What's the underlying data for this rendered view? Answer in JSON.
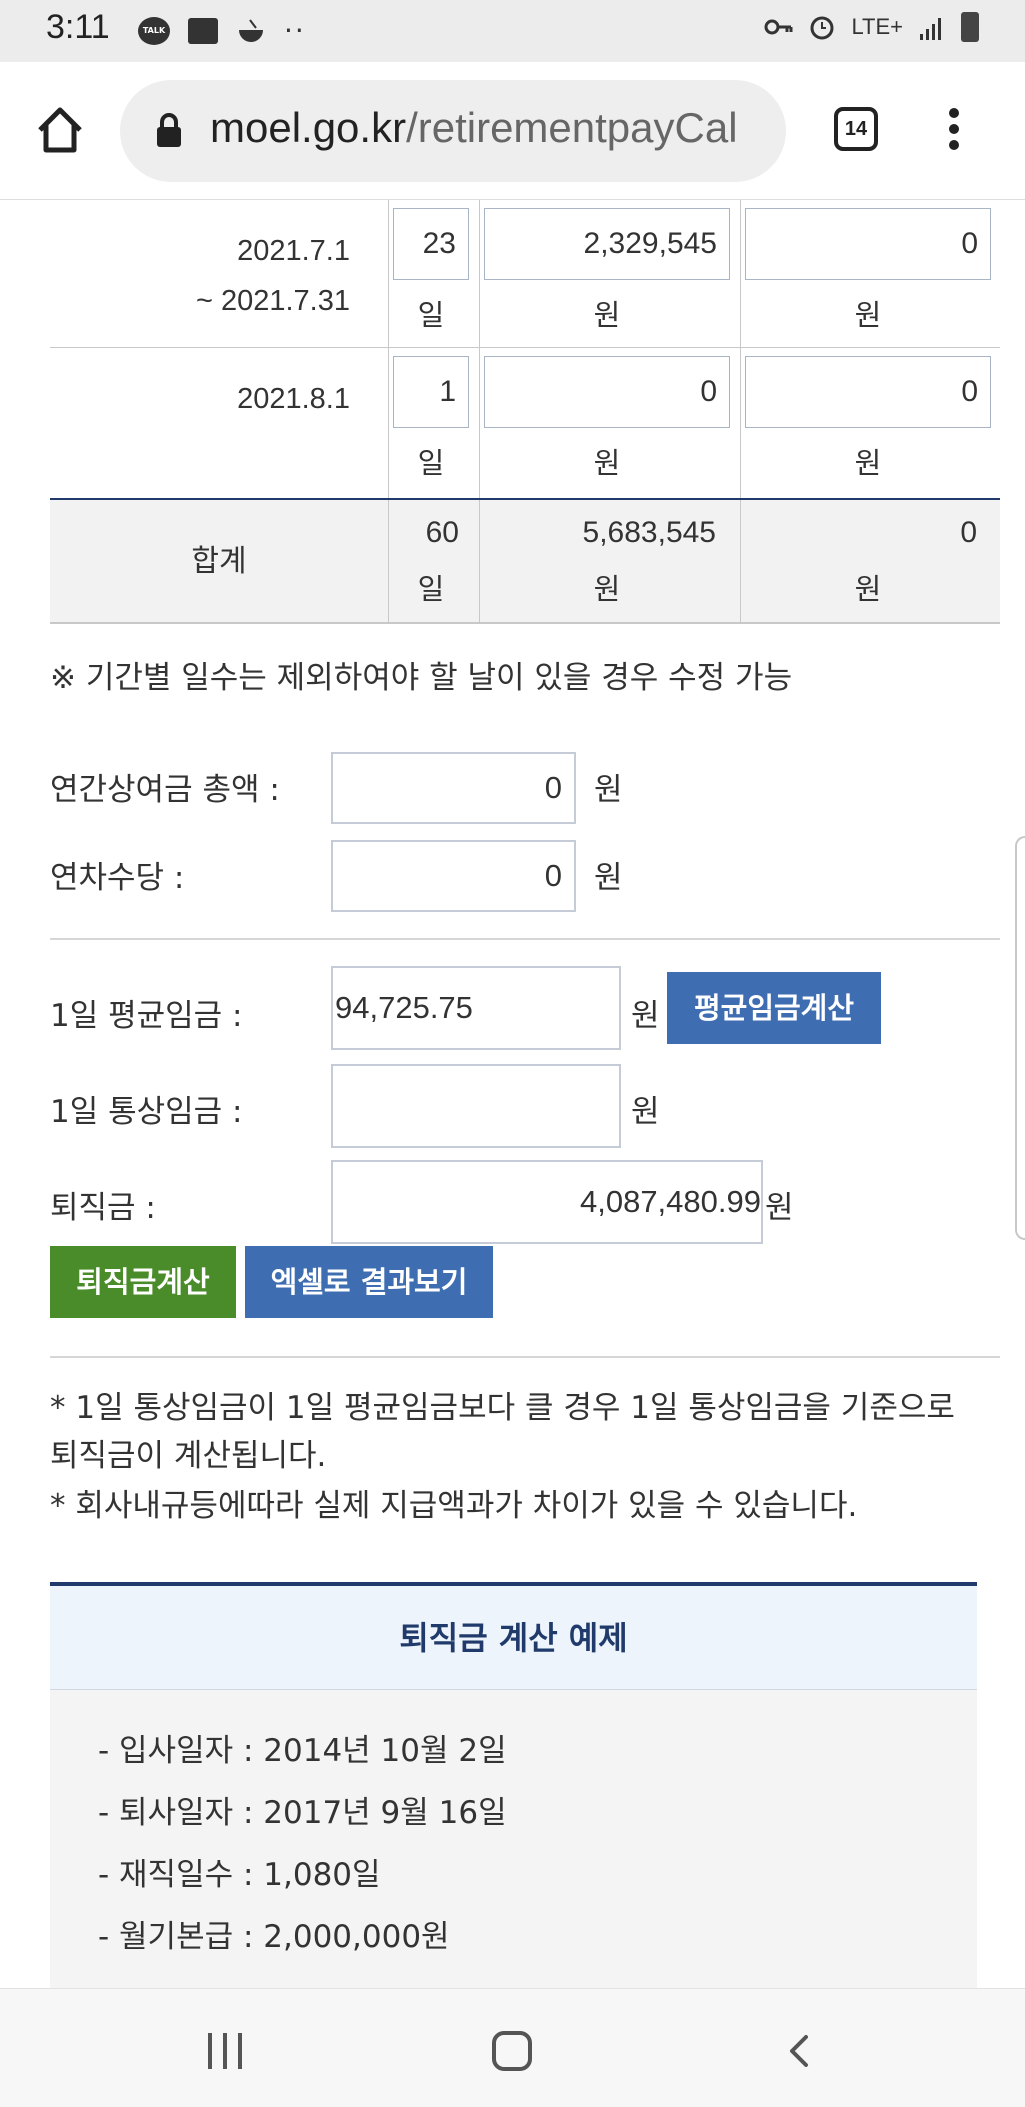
{
  "status_bar": {
    "time": "3:11",
    "talk_badge": "TALK",
    "dots": "··",
    "network": "LTE+",
    "icons": [
      "talk-icon",
      "gallery-icon",
      "bowl-icon",
      "key-icon",
      "alarm-icon",
      "signal-icon",
      "battery-icon"
    ]
  },
  "browser": {
    "url_host": "moel.go.kr",
    "url_path": "/retirementpayCal",
    "tab_count": "14"
  },
  "table": {
    "rows": [
      {
        "period_line1": "2021.7.1",
        "period_line2": "~ 2021.7.31",
        "days": "23",
        "days_unit": "일",
        "wage": "2,329,545",
        "wage_unit": "원",
        "extra": "0",
        "extra_unit": "원"
      },
      {
        "period_line1": "2021.8.1",
        "period_line2": "",
        "days": "1",
        "days_unit": "일",
        "wage": "0",
        "wage_unit": "원",
        "extra": "0",
        "extra_unit": "원"
      }
    ],
    "total": {
      "label": "합계",
      "days": "60",
      "days_unit": "일",
      "wage": "5,683,545",
      "wage_unit": "원",
      "extra": "0",
      "extra_unit": "원"
    }
  },
  "note": "※ 기간별 일수는 제외하여야 할 날이 있을 경우 수정 가능",
  "form": {
    "bonus_label": "연간상여금 총액 :",
    "bonus_value": "0",
    "bonus_unit": "원",
    "annual_allowance_label": "연차수당 :",
    "annual_allowance_value": "0",
    "annual_allowance_unit": "원",
    "avg_wage_label": "1일 평균임금 :",
    "avg_wage_value": "94,725.75",
    "avg_wage_unit": "원",
    "avg_wage_button": "평균임금계산",
    "ordinary_wage_label": "1일 통상임금 :",
    "ordinary_wage_value": "",
    "ordinary_wage_unit": "원",
    "severance_label": "퇴직금 :",
    "severance_value": "4,087,480.99",
    "severance_unit": "원",
    "calc_button": "퇴직금계산",
    "excel_button": "엑셀로 결과보기"
  },
  "footnotes": {
    "line1": "* 1일 통상임금이 1일 평균임금보다 클 경우 1일 통상임금을 기준으로 퇴직금이 계산됩니다.",
    "line2": "* 회사내규등에따라 실제 지급액과가 차이가 있을 수 있습니다."
  },
  "example": {
    "title": "퇴직금 계산 예제",
    "items": [
      "-  입사일자 : 2014년 10월 2일",
      "-  퇴사일자 : 2017년 9월 16일",
      "-  재직일수 : 1,080일",
      "-  월기본급 : 2,000,000원"
    ]
  },
  "colors": {
    "primary_blue": "#3f6db1",
    "green": "#4b8c2a",
    "navy": "#1f3a6b"
  }
}
